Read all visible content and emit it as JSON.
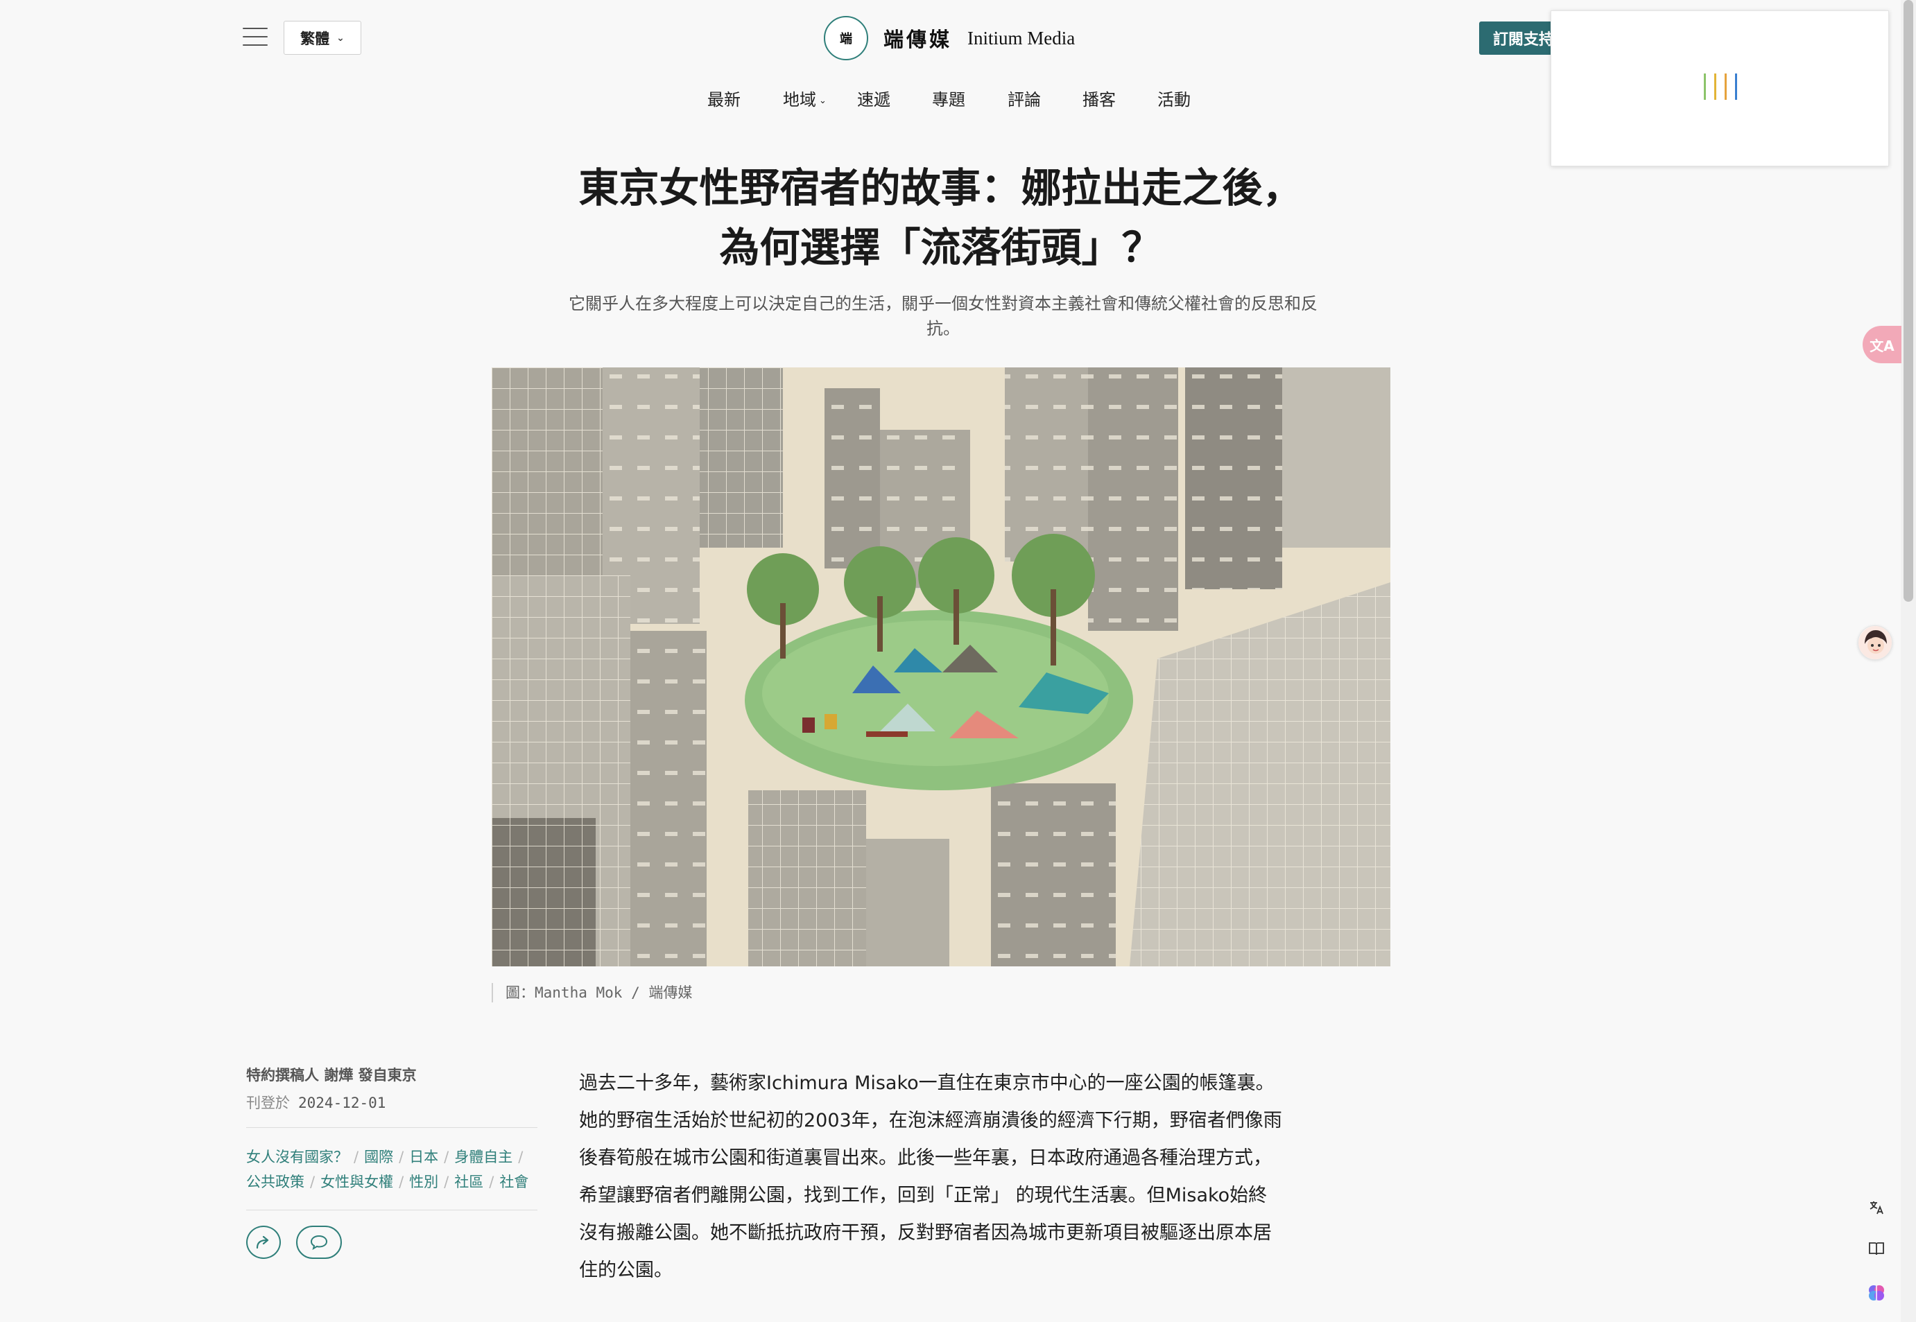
{
  "header": {
    "lang_label": "繁體",
    "brand_logo_text": "端",
    "brand_cn": "端傳媒",
    "brand_en": "Initium Media",
    "subscribe_label": "訂閱支持"
  },
  "nav": {
    "items": [
      "最新",
      "地域",
      "速遞",
      "專題",
      "評論",
      "播客",
      "活動"
    ]
  },
  "article": {
    "title_line1": "東京女性野宿者的故事：娜拉出走之後，",
    "title_line2": "為何選擇「流落街頭」？",
    "subtitle": "它關乎人在多大程度上可以決定自己的生活，關乎一個女性對資本主義社會和傳統父權社會的反思和反抗。",
    "image_credit": "圖：Mantha Mok / 端傳媒",
    "byline": "特約撰稿人 謝燁 發自東京",
    "published_label": "刊登於",
    "published_date": "2024-12-01",
    "tags": [
      "女人沒有國家？",
      "國際",
      "日本",
      "身體自主",
      "公共政策",
      "女性與女權",
      "性別",
      "社區",
      "社會"
    ],
    "body_lines": [
      "過去二十多年，藝術家Ichimura Misako一直住在東京市中心的一座公園的帳篷裏。",
      "她的野宿生活始於世紀初的2003年，在泡沫經濟崩潰後的經濟下行期，野宿者們像雨",
      "後春筍般在城市公園和街道裏冒出來。此後一些年裏，日本政府通過各種治理方式，",
      "希望讓野宿者們離開公園，找到工作，回到「正常」 的現代生活裏。但Misako始終",
      "沒有搬離公園。她不斷抵抗政府干預，反對野宿者因為城市更新項目被驅逐出原本居",
      "住的公園。"
    ]
  },
  "floating": {
    "translate_label": "文A"
  },
  "colors": {
    "brand_teal": "#2c6b71",
    "tag_teal": "#2f7f7a",
    "page_bg": "#f8f8f8"
  }
}
